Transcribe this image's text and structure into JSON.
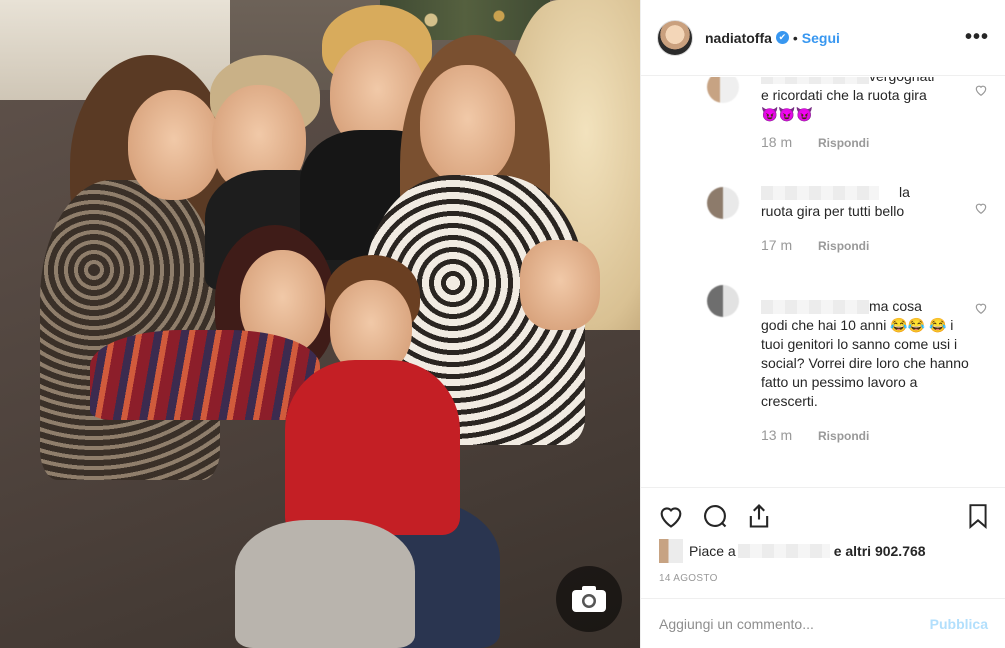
{
  "header": {
    "username": "nadiatoffa",
    "verified_mark": "✔",
    "separator": "•",
    "follow_label": "Segui",
    "more_label": "•••"
  },
  "comments": [
    {
      "text_line1": "vergognati",
      "text_rest": "e ricordati che la ruota gira",
      "emoji": "😈😈😈",
      "time": "18 m",
      "reply": "Rispondi"
    },
    {
      "text_line1": "la",
      "text_rest": "ruota gira per tutti bello",
      "emoji": "",
      "time": "17 m",
      "reply": "Rispondi"
    },
    {
      "text_line1": "ma cosa",
      "text_rest": "godi che hai 10 anni 😂😂 😂 i tuoi genitori lo sanno come usi i social? Vorrei dire loro che hanno fatto un pessimo lavoro a crescerti.",
      "emoji": "",
      "time": "13 m",
      "reply": "Rispondi"
    }
  ],
  "likes": {
    "prefix": "Piace a",
    "suffix": "e altri 902.768"
  },
  "date": "14 AGOSTO",
  "add_comment": {
    "placeholder": "Aggiungi un commento...",
    "publish": "Pubblica"
  },
  "icons": [
    "heart-icon",
    "comment-icon",
    "share-icon",
    "bookmark-icon",
    "camera-icon",
    "more-icon"
  ],
  "colors": {
    "accent": "#3897f0",
    "publish_disabled": "#b2dffc",
    "text": "#262626",
    "muted": "#999999"
  }
}
